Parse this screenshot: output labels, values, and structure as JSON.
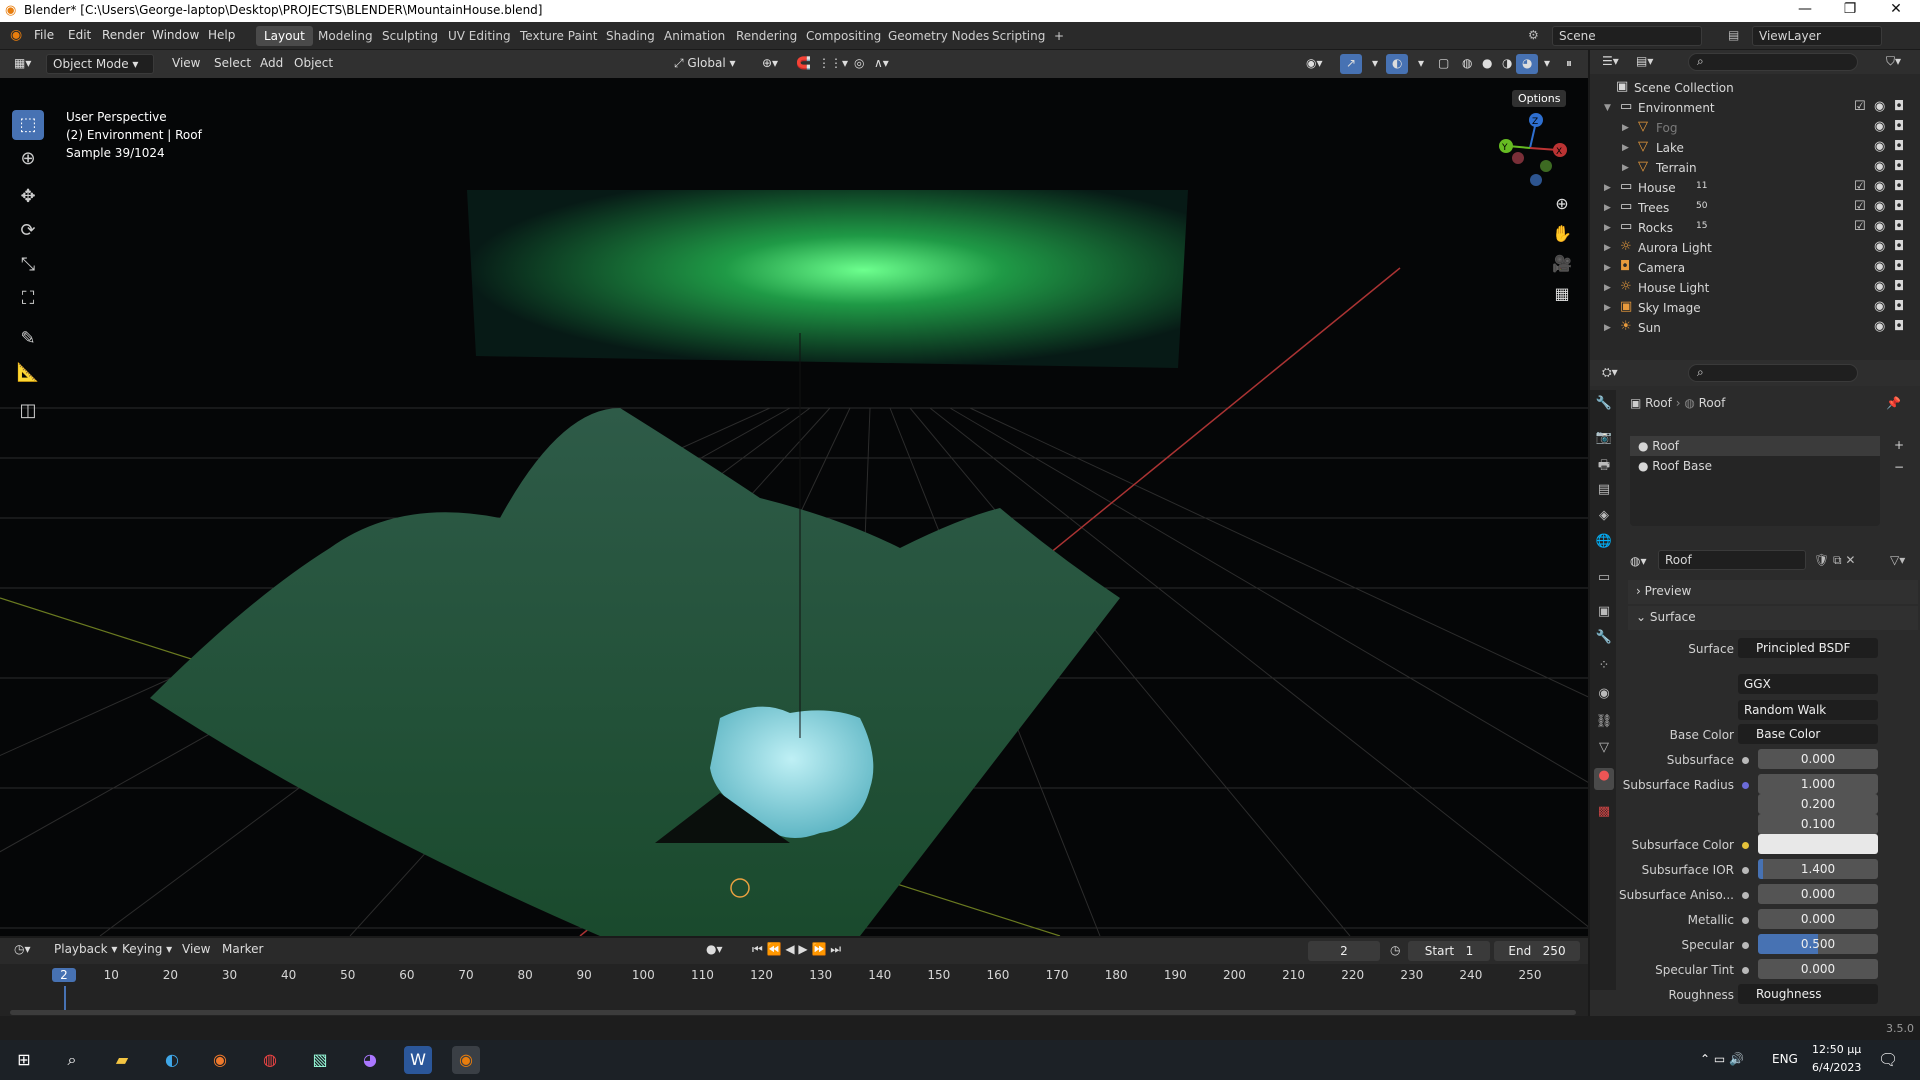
{
  "window": {
    "title": "Blender* [C:\\Users\\George-laptop\\Desktop\\PROJECTS\\BLENDER\\MountainHouse.blend]"
  },
  "menu": [
    "File",
    "Edit",
    "Render",
    "Window",
    "Help"
  ],
  "workspaces": [
    "Layout",
    "Modeling",
    "Sculpting",
    "UV Editing",
    "Texture Paint",
    "Shading",
    "Animation",
    "Rendering",
    "Compositing",
    "Geometry Nodes",
    "Scripting",
    "+"
  ],
  "scene": {
    "name": "Scene",
    "view_layer": "ViewLayer"
  },
  "viewport_header": {
    "mode": "Object Mode",
    "view": "View",
    "select": "Select",
    "add": "Add",
    "object": "Object",
    "orientation": "Global",
    "options": "Options"
  },
  "viewport_info": {
    "line1": "User Perspective",
    "line2": "(2) Environment | Roof",
    "line3": "Sample 39/1024"
  },
  "gizmo": {
    "x": "X",
    "y": "Y",
    "z": "Z"
  },
  "outliner": {
    "root": "Scene Collection",
    "items": [
      {
        "label": "Environment",
        "depth": 0,
        "icon": "collection-icon"
      },
      {
        "label": "Fog",
        "depth": 1,
        "icon": "mesh-icon",
        "dim": true
      },
      {
        "label": "Lake",
        "depth": 1,
        "icon": "mesh-icon"
      },
      {
        "label": "Terrain",
        "depth": 1,
        "icon": "mesh-icon"
      },
      {
        "label": "House",
        "depth": 0,
        "icon": "collection-icon",
        "badge": "11"
      },
      {
        "label": "Trees",
        "depth": 0,
        "icon": "collection-icon",
        "badge": "50"
      },
      {
        "label": "Rocks",
        "depth": 0,
        "icon": "collection-icon",
        "badge": "15"
      },
      {
        "label": "Aurora Light",
        "depth": 0,
        "icon": "light-icon"
      },
      {
        "label": "Camera",
        "depth": 0,
        "icon": "camera-icon"
      },
      {
        "label": "House Light",
        "depth": 0,
        "icon": "light-icon"
      },
      {
        "label": "Sky Image",
        "depth": 0,
        "icon": "image-icon"
      },
      {
        "label": "Sun",
        "depth": 0,
        "icon": "sun-icon"
      }
    ]
  },
  "properties": {
    "breadcrumb": [
      "Roof",
      "Roof"
    ],
    "slots": [
      "Roof",
      "Roof Base"
    ],
    "material_name": "Roof",
    "panels": {
      "preview": "Preview",
      "surface": "Surface"
    },
    "surface_shader": "Principled BSDF",
    "distribution": "GGX",
    "subsurface_method": "Random Walk",
    "rows": [
      {
        "label": "Base Color",
        "value": "Base Color",
        "kind": "link"
      },
      {
        "label": "Subsurface",
        "value": "0.000",
        "kind": "num"
      },
      {
        "label": "Subsurface Radius",
        "value": "1.000",
        "kind": "num"
      },
      {
        "label": "",
        "value": "0.200",
        "kind": "num"
      },
      {
        "label": "",
        "value": "0.100",
        "kind": "num"
      },
      {
        "label": "Subsurface Color",
        "value": "",
        "kind": "color"
      },
      {
        "label": "Subsurface IOR",
        "value": "1.400",
        "kind": "slider",
        "fill": 0.04
      },
      {
        "label": "Subsurface Aniso...",
        "value": "0.000",
        "kind": "num"
      },
      {
        "label": "Metallic",
        "value": "0.000",
        "kind": "num"
      },
      {
        "label": "Specular",
        "value": "0.500",
        "kind": "slider",
        "fill": 0.5
      },
      {
        "label": "Specular Tint",
        "value": "0.000",
        "kind": "num"
      },
      {
        "label": "Roughness",
        "value": "Roughness",
        "kind": "link"
      }
    ]
  },
  "timeline": {
    "menus": [
      "Playback",
      "Keying",
      "View",
      "Marker"
    ],
    "current_frame": "2",
    "start_label": "Start",
    "start": "1",
    "end_label": "End",
    "end": "250",
    "ticks": [
      "2",
      "10",
      "20",
      "30",
      "40",
      "50",
      "60",
      "70",
      "80",
      "90",
      "100",
      "110",
      "120",
      "130",
      "140",
      "150",
      "160",
      "170",
      "180",
      "190",
      "200",
      "210",
      "220",
      "230",
      "240",
      "250"
    ]
  },
  "version": "3.5.0",
  "taskbar": {
    "lang": "ENG",
    "time": "12:50 μμ",
    "date": "6/4/2023"
  },
  "colors": {
    "accent": "#4772b3",
    "viewport_bg": "#050607",
    "aurora": "#3ecf6a",
    "terrain": "#1f4a33",
    "lake": "#8fd6e0",
    "grid": "#3a3a3a"
  }
}
